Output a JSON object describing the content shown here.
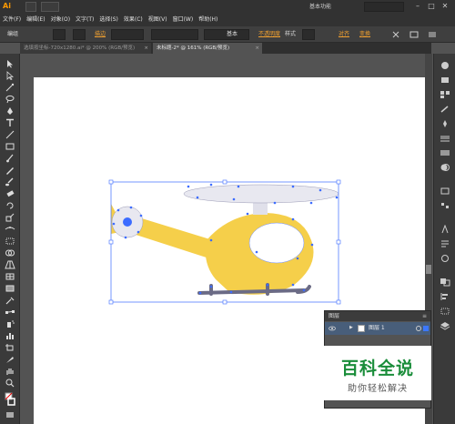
{
  "app": {
    "logo": "Ai",
    "workspace": "基本功能"
  },
  "menu": [
    "文件(F)",
    "编辑(E)",
    "对象(O)",
    "文字(T)",
    "选择(S)",
    "效果(C)",
    "视图(V)",
    "窗口(W)",
    "帮助(H)"
  ],
  "control": {
    "selection_label": "编组",
    "stroke_label": "描边",
    "stroke_style": "基本",
    "opacity_label": "不透明度",
    "style_label": "样式",
    "align_label": "对齐",
    "transform_label": "变换"
  },
  "tabs": [
    {
      "label": "选填按坐标-720x1280.ai* @ 200% (RGB/预览)",
      "active": false
    },
    {
      "label": "未标题-2* @ 161% (RGB/预览)",
      "active": true
    }
  ],
  "layers": {
    "title": "图层",
    "menu": "≡",
    "row": {
      "name": "图层 1",
      "arrow": "▶"
    }
  },
  "watermark": {
    "title": "百科全说",
    "subtitle": "助你轻松解决"
  },
  "colors": {
    "helicopter_body": "#f5cf4a",
    "rotor": "#e8e8f0",
    "skids": "#6b6b85",
    "selection": "#3c6cff",
    "watermark_green": "#1a8d3a"
  }
}
